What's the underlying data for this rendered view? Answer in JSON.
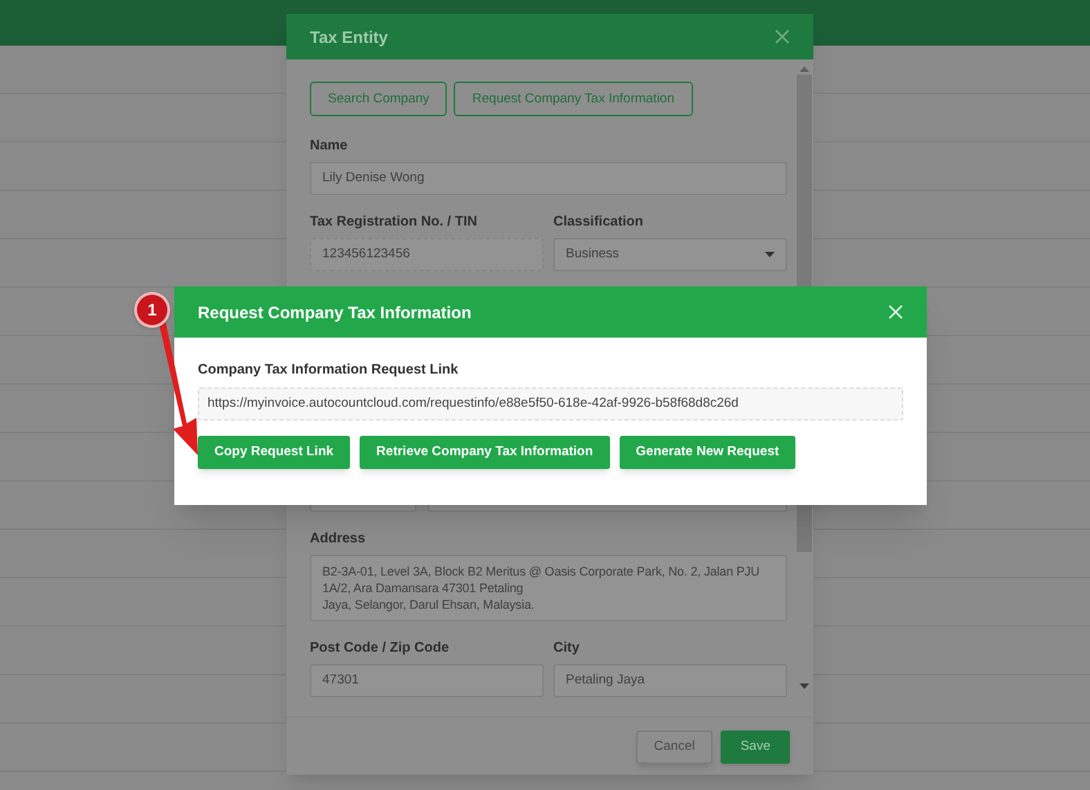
{
  "tax_entity": {
    "title": "Tax Entity",
    "top_buttons": [
      "Search Company",
      "Request Company Tax Information"
    ],
    "rows": [
      [
        {
          "label": "Name",
          "value": "Lily Denise Wong",
          "kind": "text"
        }
      ],
      [
        {
          "label": "Tax Registration No. / TIN",
          "value": "123456123456",
          "kind": "readonly"
        },
        {
          "label": "Classification",
          "value": "Business",
          "kind": "select"
        }
      ],
      [
        {
          "label": "Address",
          "value": "B2-3A-01, Level 3A, Block B2 Meritus @ Oasis Corporate Park, No. 2, Jalan PJU 1A/2, Ara Damansara 47301 Petaling\nJaya, Selangor, Darul Ehsan, Malaysia.",
          "kind": "textarea"
        }
      ],
      [
        {
          "label": "Post Code / Zip Code",
          "value": "47301",
          "kind": "text"
        },
        {
          "label": "City",
          "value": "Petaling Jaya",
          "kind": "text"
        }
      ]
    ],
    "footer_buttons": [
      {
        "label": "Cancel",
        "kind": "secondary"
      },
      {
        "label": "Save",
        "kind": "primary"
      }
    ]
  },
  "dialog": {
    "title": "Request Company Tax Information",
    "field_label": "Company Tax Information Request Link",
    "link": "https://myinvoice.autocountcloud.com/requestinfo/e88e5f50-618e-42af-9926-b58f68d8c26d",
    "buttons": [
      "Copy Request Link",
      "Retrieve Company Tax Information",
      "Generate New Request"
    ]
  },
  "annotation": {
    "number": "1"
  }
}
